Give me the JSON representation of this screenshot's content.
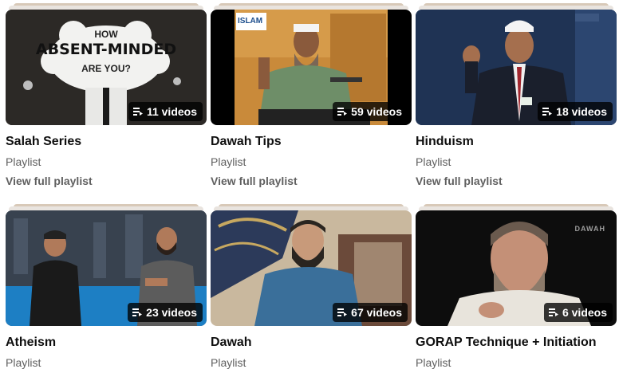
{
  "playlists": [
    {
      "title": "Salah Series",
      "subtitle": "Playlist",
      "link": "View full playlist",
      "count": "11 videos",
      "thumb_text": [
        "HOW",
        "ABSENT-MINDED",
        "ARE YOU?"
      ]
    },
    {
      "title": "Dawah Tips",
      "subtitle": "Playlist",
      "link": "View full playlist",
      "count": "59 videos",
      "thumb_text": [
        "ISLAM"
      ]
    },
    {
      "title": "Hinduism",
      "subtitle": "Playlist",
      "link": "View full playlist",
      "count": "18 videos",
      "thumb_text": []
    },
    {
      "title": "Atheism",
      "subtitle": "Playlist",
      "link": "",
      "count": "23 videos",
      "thumb_text": []
    },
    {
      "title": "Dawah",
      "subtitle": "Playlist",
      "link": "",
      "count": "67 videos",
      "thumb_text": []
    },
    {
      "title": "GORAP Technique + Initiation",
      "subtitle": "Playlist",
      "link": "",
      "count": "6 videos",
      "thumb_text": [
        "DAWAH"
      ]
    }
  ],
  "icons": {
    "badge": "playlist-icon"
  },
  "colors": {
    "title": "#0f0f0f",
    "meta": "#606060",
    "badge_bg": "#000000"
  }
}
